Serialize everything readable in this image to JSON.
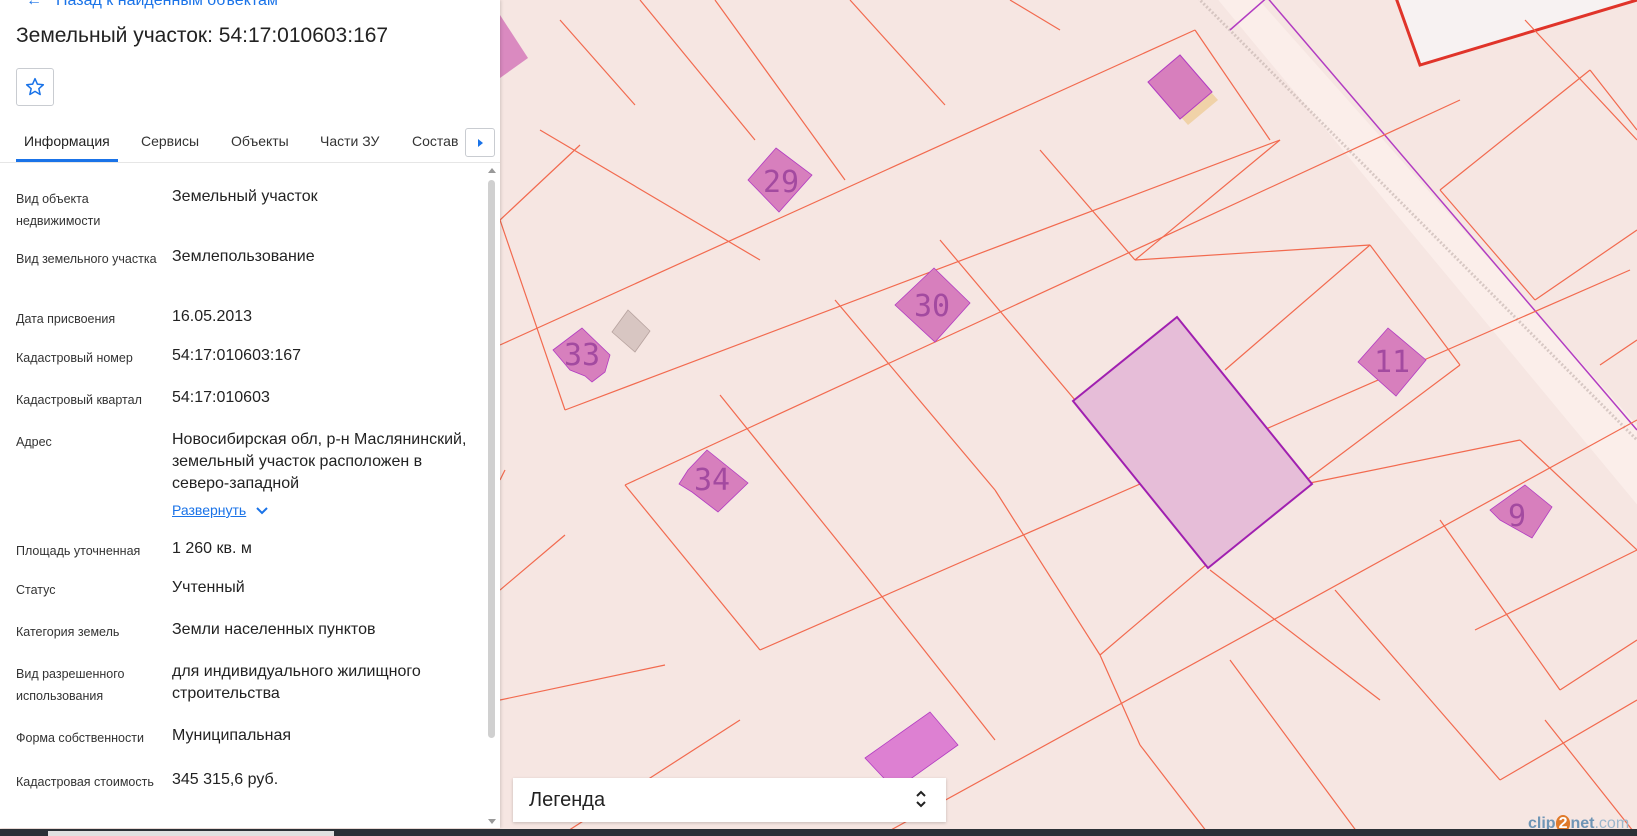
{
  "panel": {
    "back_link": "Назад к найденным объектам",
    "title": "Земельный участок: 54:17:010603:167",
    "tabs": [
      "Информация",
      "Сервисы",
      "Объекты",
      "Части ЗУ",
      "Состав"
    ],
    "active_tab": "Информация",
    "fields": [
      {
        "label": "Вид объекта недвижимости",
        "value": "Земельный участок"
      },
      {
        "label": "Вид земельного участка",
        "value": "Землепользование"
      },
      {
        "label": "Дата присвоения",
        "value": "16.05.2013"
      },
      {
        "label": "Кадастровый номер",
        "value": "54:17:010603:167"
      },
      {
        "label": "Кадастровый квартал",
        "value": "54:17:010603"
      },
      {
        "label": "Адрес",
        "value": "Новосибирская обл, р-н Маслянинский, земельный участок расположен в северо-западной"
      },
      {
        "label": "Площадь уточненная",
        "value": "1 260 кв. м"
      },
      {
        "label": "Статус",
        "value": "Учтенный"
      },
      {
        "label": "Категория земель",
        "value": "Земли населенных пунктов"
      },
      {
        "label": "Вид разрешенного использования",
        "value": "для индивидуального жилищного строительства"
      },
      {
        "label": "Форма собственности",
        "value": "Муниципальная"
      },
      {
        "label": "Кадастровая стоимость",
        "value": "345 315,6 руб."
      }
    ],
    "expand_link": "Развернуть"
  },
  "map": {
    "plot_numbers": [
      "29",
      "30",
      "33",
      "34",
      "11",
      "9"
    ],
    "colors": {
      "background": "#f6e6e2",
      "parcel_line": "#f26a4f",
      "selected_fill": "#e6bdd8",
      "selected_stroke": "#a020b0",
      "building_fill": "#d77fbd",
      "road": "#fbeeea"
    }
  },
  "legend": {
    "title": "Легенда"
  },
  "watermark": {
    "part1": "clip",
    "part2": "2",
    "part3": "net",
    "part4": ".com"
  }
}
